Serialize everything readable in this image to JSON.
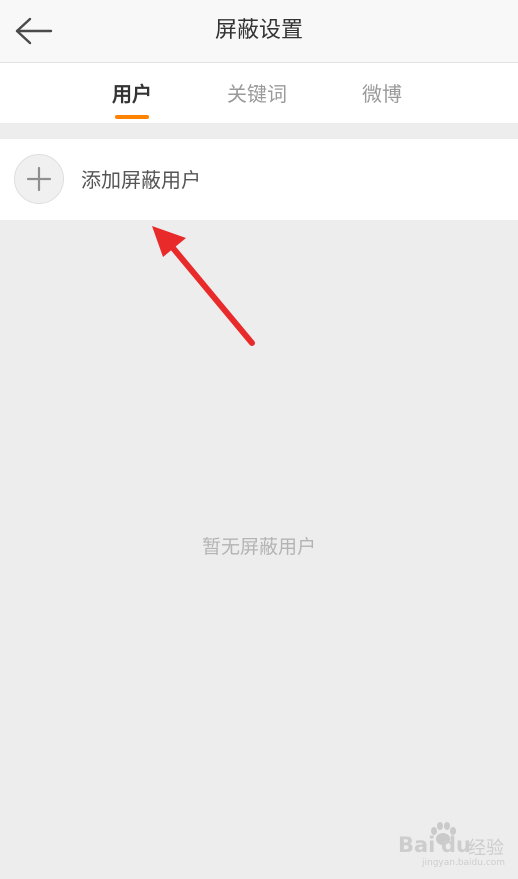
{
  "header": {
    "title": "屏蔽设置",
    "back_icon": "arrow-left-icon"
  },
  "tabs": [
    {
      "label": "用户",
      "active": true
    },
    {
      "label": "关键词",
      "active": false
    },
    {
      "label": "微博",
      "active": false
    }
  ],
  "add_row": {
    "label": "添加屏蔽用户",
    "icon": "plus-icon"
  },
  "empty_state": {
    "text": "暂无屏蔽用户"
  },
  "watermark": {
    "brand": "Bai",
    "brand2": "du",
    "suffix": "经验",
    "sub": "jingyan.baidu.com"
  },
  "colors": {
    "accent": "#ff8200",
    "arrow": "#e82a2a",
    "background": "#ededed"
  }
}
